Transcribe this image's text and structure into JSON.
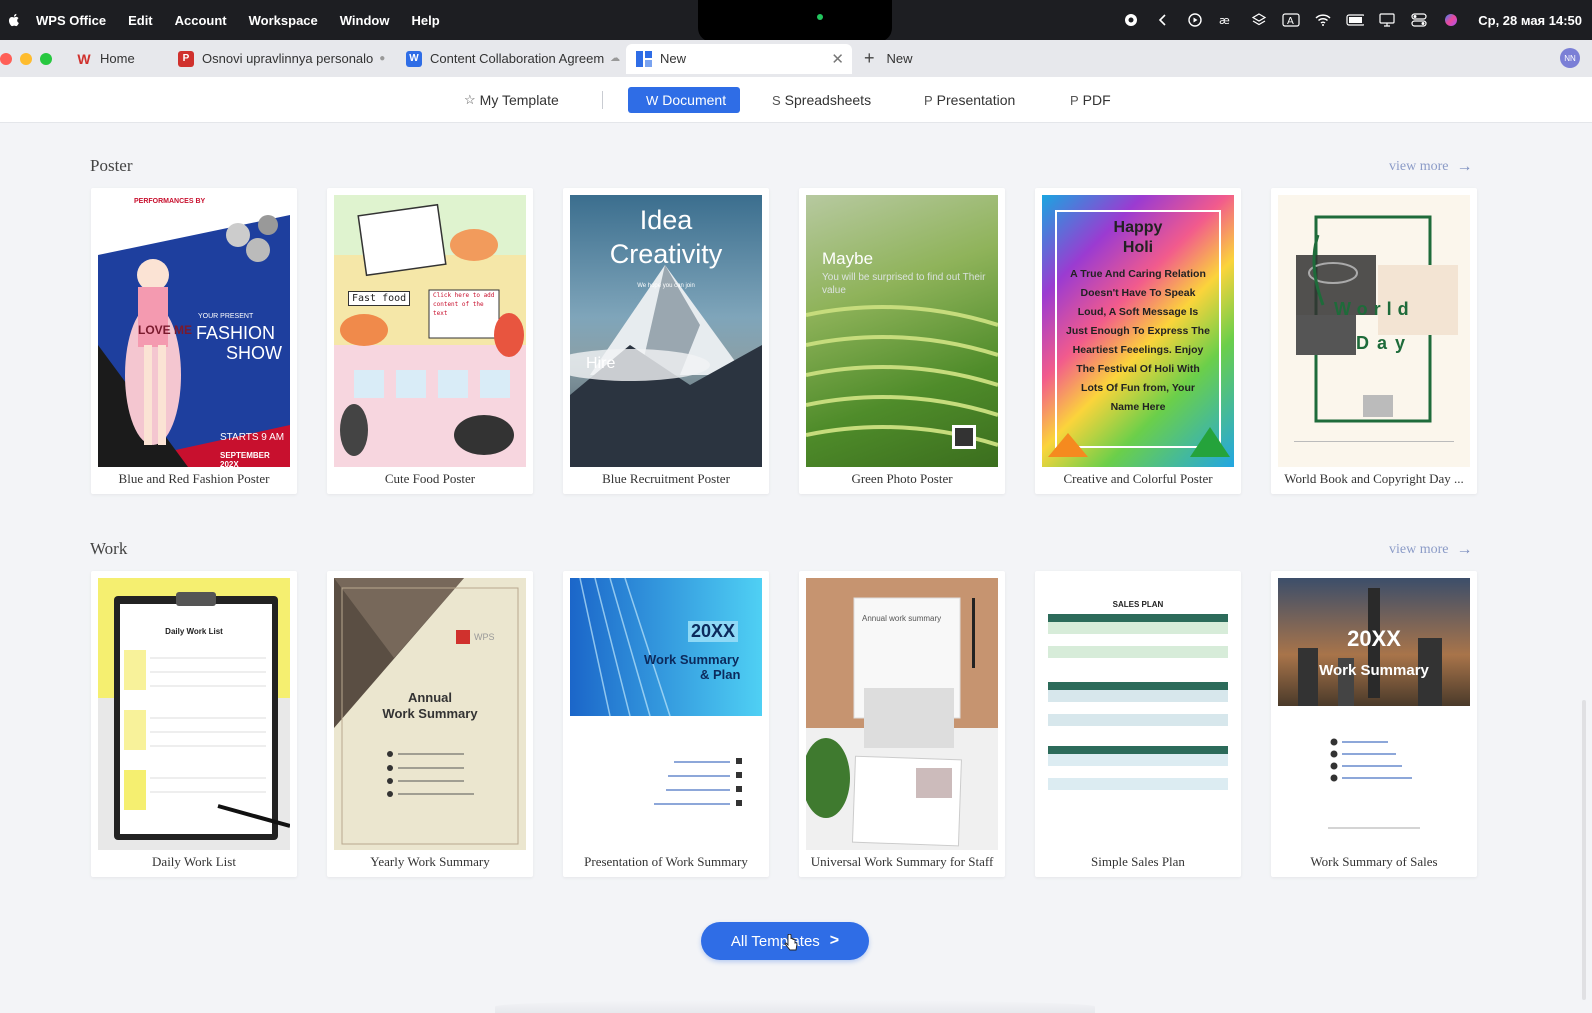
{
  "menubar": {
    "app_name": "WPS Office",
    "items": [
      "Edit",
      "Account",
      "Workspace",
      "Window",
      "Help"
    ],
    "clock": "Ср, 28 мая  14:50"
  },
  "tabs": {
    "home": "Home",
    "doc1": "Osnovi upravlinnya personalo",
    "doc2": "Content Collaboration Agreem",
    "active": "New",
    "new_tab": "New",
    "avatar": "NN"
  },
  "categories": {
    "my_template": "My Template",
    "document": "Document",
    "spreadsheets": "Spreadsheets",
    "presentation": "Presentation",
    "pdf": "PDF"
  },
  "poster": {
    "title": "Poster",
    "view_more": "view more",
    "cards": [
      "Blue and Red Fashion Poster",
      "Cute Food Poster",
      "Blue Recruitment Poster",
      "Green Photo Poster",
      "Creative and Colorful Poster",
      "World Book and Copyright Day ..."
    ]
  },
  "work": {
    "title": "Work",
    "view_more": "view more",
    "cards": [
      "Daily Work List",
      "Yearly Work Summary",
      "Presentation of Work Summary",
      "Universal Work Summary for Staff",
      "Simple Sales Plan",
      "Work Summary of Sales"
    ]
  },
  "thumbs": {
    "fashion": {
      "top": "PERFORMANCES BY",
      "present": "YOUR PRESENT",
      "title1": "FASHION",
      "title2": "SHOW",
      "starts": "STARTS  9 AM",
      "date": "SEPTEMBER 202X",
      "love": "LOVE ME"
    },
    "food": {
      "label": "Fast food",
      "note": "Click here to add content of the text"
    },
    "idea": {
      "line1": "Idea",
      "line2": "Creativity",
      "hire": "Hire",
      "sub": "We hope you can join"
    },
    "green": {
      "maybe": "Maybe",
      "sub": "You will be surprised to find out Their value"
    },
    "holi": {
      "title1": "Happy",
      "title2": "Holi",
      "body": "A True And Caring Relation Doesn't Have To Speak Loud, A Soft Message Is Just Enough To Express The Heartiest Feeelings. Enjoy The Festival Of Holi With Lots Of Fun from, Your Name Here"
    },
    "world": {
      "w1": "World",
      "w2": "Day"
    },
    "daily": {
      "title": "Daily Work List"
    },
    "yearly": {
      "line1": "Annual",
      "line2": "Work Summary",
      "brand": "WPS"
    },
    "pres": {
      "year": "20XX",
      "line1": "Work Summary",
      "line2": "& Plan"
    },
    "universal": {
      "title": "Annual work summary"
    },
    "sales": {
      "title": "SALES PLAN"
    },
    "wsales": {
      "year": "20XX",
      "line": "Work Summary"
    }
  },
  "all_templates": "All Templates",
  "colors": {
    "accent": "#2f6de6",
    "background": "#f3f4f7",
    "menubar": "#1d1e22"
  }
}
